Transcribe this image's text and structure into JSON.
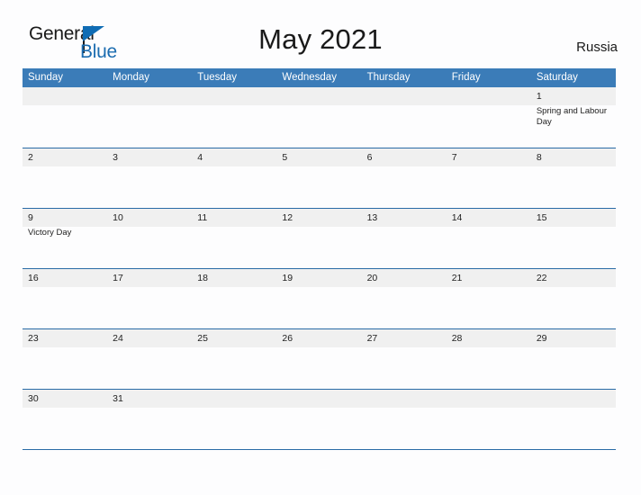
{
  "brand": {
    "word_one": "General",
    "word_two": "Blue",
    "accent_color": "#1b6cb0",
    "triangle_icon": "triangle-right-icon"
  },
  "header": {
    "title": "May 2021",
    "country": "Russia",
    "header_bar_color": "#3b7cb8",
    "band_color": "#f0f0f0",
    "rule_color": "#2a6ba6"
  },
  "weekdays": [
    "Sunday",
    "Monday",
    "Tuesday",
    "Wednesday",
    "Thursday",
    "Friday",
    "Saturday"
  ],
  "weeks": [
    [
      {
        "day": "",
        "event": ""
      },
      {
        "day": "",
        "event": ""
      },
      {
        "day": "",
        "event": ""
      },
      {
        "day": "",
        "event": ""
      },
      {
        "day": "",
        "event": ""
      },
      {
        "day": "",
        "event": ""
      },
      {
        "day": "1",
        "event": "Spring and Labour Day"
      }
    ],
    [
      {
        "day": "2",
        "event": ""
      },
      {
        "day": "3",
        "event": ""
      },
      {
        "day": "4",
        "event": ""
      },
      {
        "day": "5",
        "event": ""
      },
      {
        "day": "6",
        "event": ""
      },
      {
        "day": "7",
        "event": ""
      },
      {
        "day": "8",
        "event": ""
      }
    ],
    [
      {
        "day": "9",
        "event": "Victory Day"
      },
      {
        "day": "10",
        "event": ""
      },
      {
        "day": "11",
        "event": ""
      },
      {
        "day": "12",
        "event": ""
      },
      {
        "day": "13",
        "event": ""
      },
      {
        "day": "14",
        "event": ""
      },
      {
        "day": "15",
        "event": ""
      }
    ],
    [
      {
        "day": "16",
        "event": ""
      },
      {
        "day": "17",
        "event": ""
      },
      {
        "day": "18",
        "event": ""
      },
      {
        "day": "19",
        "event": ""
      },
      {
        "day": "20",
        "event": ""
      },
      {
        "day": "21",
        "event": ""
      },
      {
        "day": "22",
        "event": ""
      }
    ],
    [
      {
        "day": "23",
        "event": ""
      },
      {
        "day": "24",
        "event": ""
      },
      {
        "day": "25",
        "event": ""
      },
      {
        "day": "26",
        "event": ""
      },
      {
        "day": "27",
        "event": ""
      },
      {
        "day": "28",
        "event": ""
      },
      {
        "day": "29",
        "event": ""
      }
    ],
    [
      {
        "day": "30",
        "event": ""
      },
      {
        "day": "31",
        "event": ""
      },
      {
        "day": "",
        "event": ""
      },
      {
        "day": "",
        "event": ""
      },
      {
        "day": "",
        "event": ""
      },
      {
        "day": "",
        "event": ""
      },
      {
        "day": "",
        "event": ""
      }
    ]
  ]
}
